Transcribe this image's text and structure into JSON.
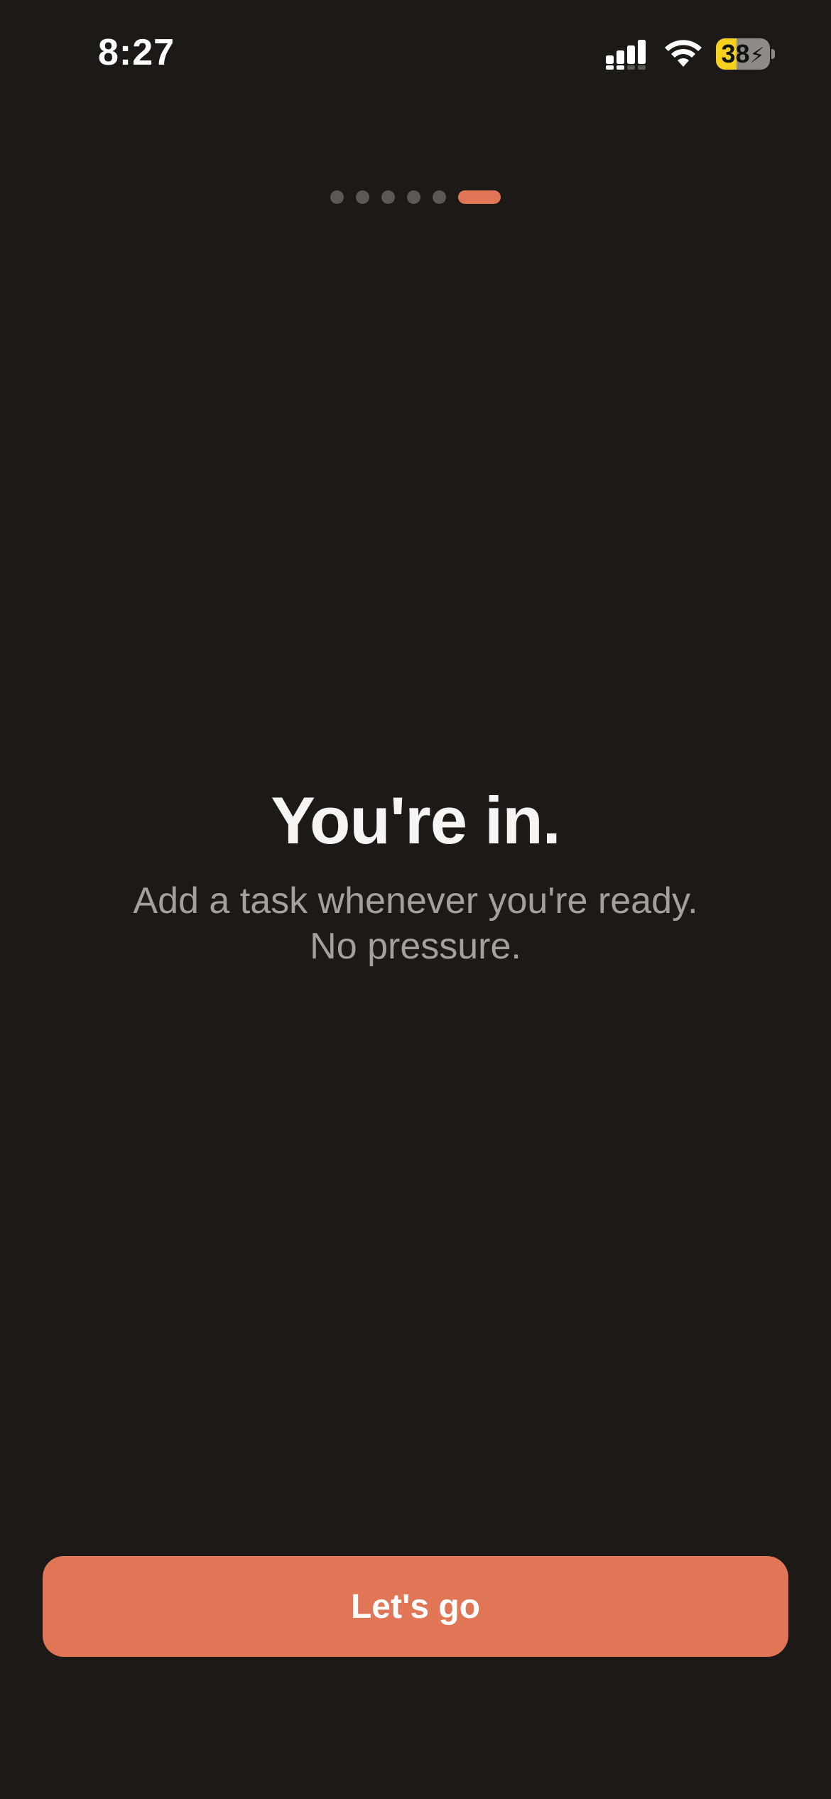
{
  "status_bar": {
    "time": "8:27",
    "battery": {
      "level_percent": 38,
      "label": "38",
      "charging": true,
      "fill_color": "#f5d01c"
    },
    "icons": [
      "signal-icon",
      "wifi-icon",
      "battery-icon",
      "charging-bolt-icon"
    ]
  },
  "onboarding": {
    "page_count": 6,
    "current_page": 6,
    "accent_color": "#e07656",
    "headline": "You're in.",
    "subtitle_line1": "Add a task whenever you're ready.",
    "subtitle_line2": "No pressure.",
    "cta_label": "Let's go"
  },
  "colors": {
    "background": "#1d1917",
    "accent": "#e07656",
    "subtitle": "#a5a09c",
    "inactive_dot": "#5c5856"
  }
}
